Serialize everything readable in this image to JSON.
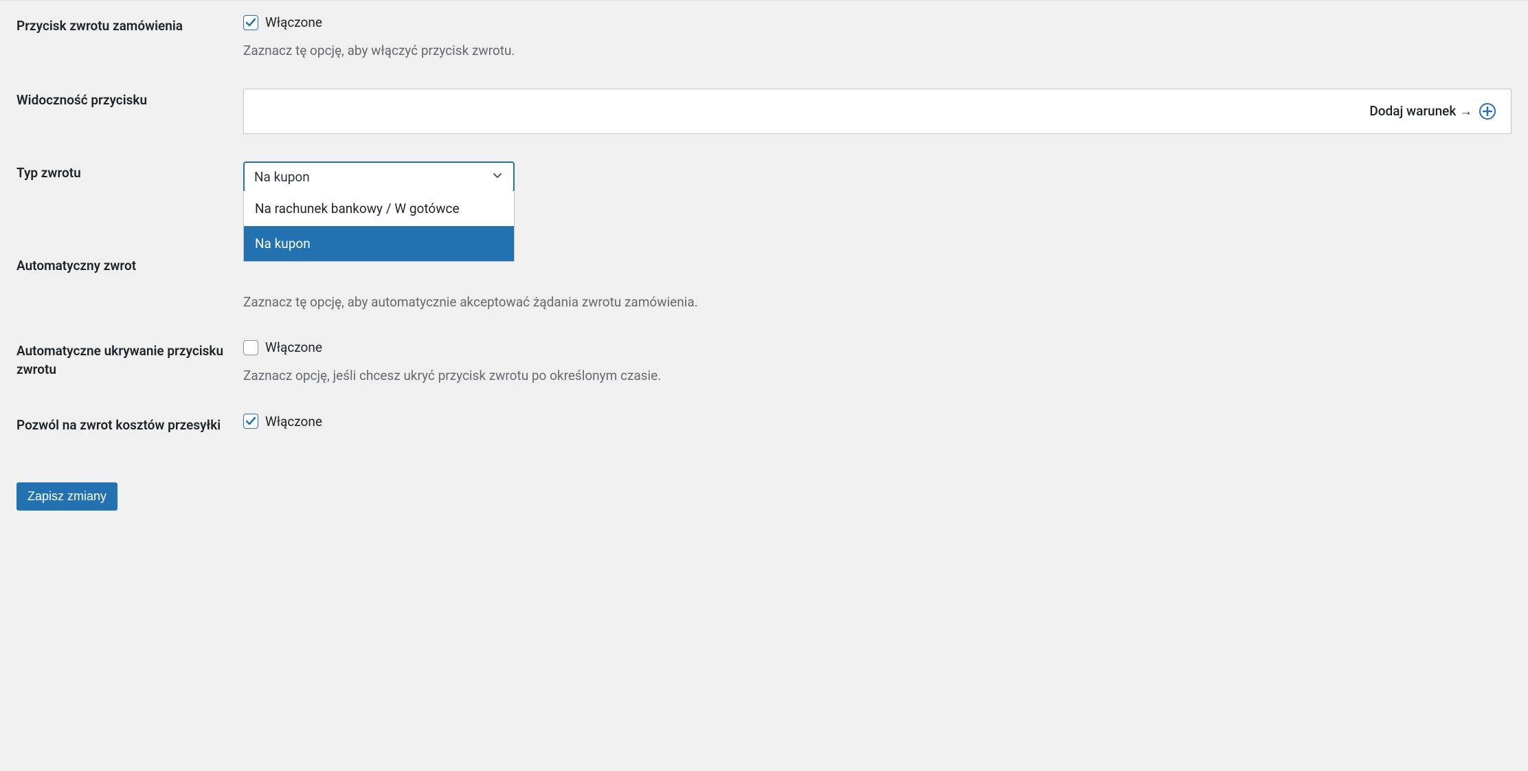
{
  "settings": {
    "return_button": {
      "label": "Przycisk zwrotu zamówienia",
      "checkbox_label": "Włączone",
      "description": "Zaznacz tę opcję, aby włączyć przycisk zwrotu."
    },
    "button_visibility": {
      "label": "Widoczność przycisku",
      "add_condition": "Dodaj warunek →"
    },
    "return_type": {
      "label": "Typ zwrotu",
      "selected": "Na kupon",
      "options": [
        "Na rachunek bankowy / W gotówce",
        "Na kupon"
      ]
    },
    "auto_return": {
      "label": "Automatyczny zwrot",
      "description": "Zaznacz tę opcję, aby automatycznie akceptować żądania zwrotu zamówienia."
    },
    "auto_hide": {
      "label": "Automatyczne ukrywanie przycisku zwrotu",
      "checkbox_label": "Włączone",
      "description": "Zaznacz opcję, jeśli chcesz ukryć przycisk zwrotu po określonym czasie."
    },
    "allow_shipping_refund": {
      "label": "Pozwól na zwrot kosztów przesyłki",
      "checkbox_label": "Włączone"
    }
  },
  "actions": {
    "save": "Zapisz zmiany"
  }
}
